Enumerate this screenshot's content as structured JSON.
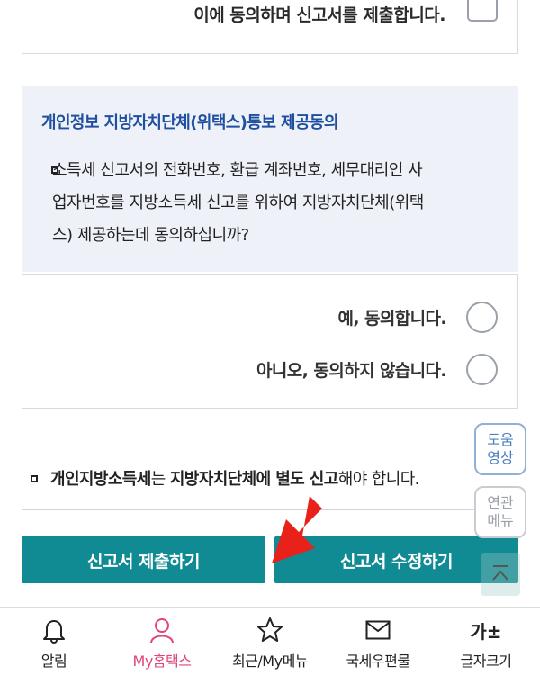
{
  "top_consent": {
    "label": "이에 동의하며 신고서를 제출합니다."
  },
  "section": {
    "title": "개인정보 지방자치단체(위택스)통보 제공동의",
    "question_line1": "소득세 신고서의 전화번호, 환급 계좌번호, 세무대리인 사",
    "question_line2": "업자번호를 지방소득세 신고를 위하여 지방자치단체(위택",
    "question_line3": "스) 제공하는데 동의하십니까?"
  },
  "options": {
    "agree": "예, 동의합니다.",
    "disagree": "아니오, 동의하지 않습니다."
  },
  "notice": {
    "part1_bold": "개인지방소득세",
    "part2": "는 ",
    "part3_bold": "지방자치단체에 별도 신고",
    "part4": "해야 합니다."
  },
  "buttons": {
    "submit": "신고서 제출하기",
    "edit": "신고서 수정하기"
  },
  "floating": {
    "help_line1": "도움",
    "help_line2": "영상",
    "related_line1": "연관",
    "related_line2": "메뉴"
  },
  "bottom_nav": {
    "items": [
      {
        "label": "알림",
        "icon": "bell-icon"
      },
      {
        "label": "My홈택스",
        "icon": "person-icon",
        "active": true
      },
      {
        "label": "최근/My메뉴",
        "icon": "star-icon"
      },
      {
        "label": "국세우편물",
        "icon": "mail-icon"
      },
      {
        "label": "글자크기",
        "icon": "font-size-icon",
        "icon_text": "가±"
      }
    ]
  },
  "colors": {
    "primary_button": "#108a93",
    "section_title": "#1f4fa0",
    "active_nav": "#e0457b",
    "arrow": "#e8221b"
  }
}
